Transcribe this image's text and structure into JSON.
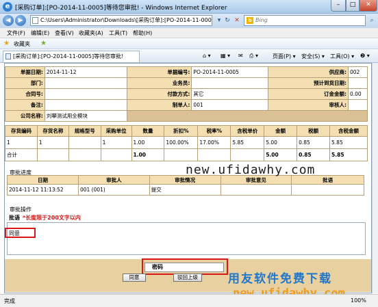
{
  "window": {
    "title": "[采购订单]:[PO-2014-11-0005]等待您审批! - Windows Internet Explorer"
  },
  "addressbar": {
    "url": "C:\\Users\\Administrator\\Downloads\\[采购订单]:[PO-2014-11-0005",
    "search_placeholder": "Bing"
  },
  "menu": [
    "文件(F)",
    "编辑(E)",
    "查看(V)",
    "收藏夹(A)",
    "工具(T)",
    "帮助(H)"
  ],
  "favorites": {
    "label": "收藏夹"
  },
  "tab": {
    "label": "[采购订单]:[PO-2014-11-0005]等待您审批!"
  },
  "commandbar": {
    "page": "页面(P) ▾",
    "safety": "安全(S) ▾",
    "tools": "工具(O) ▾",
    "help": "❷ ▾"
  },
  "header_form": {
    "doc_date_label": "单据日期:",
    "doc_date": "2014-11-12",
    "doc_no_label": "单据编号:",
    "doc_no": "PO-2014-11-0005",
    "supplier_label": "供应商:",
    "supplier": "002",
    "dept_label": "部门:",
    "dept": "",
    "salesman_label": "业务员:",
    "salesman": "",
    "arrival_label": "预计到货日期:",
    "arrival": "",
    "contract_label": "合同号:",
    "contract": "",
    "payment_label": "付款方式:",
    "payment": "其它",
    "deposit_label": "订金金额:",
    "deposit": "0.00",
    "remark_label": "备注:",
    "remark": "",
    "maker_label": "制单人:",
    "maker": "001",
    "auditor_label": "审核人:",
    "auditor": "",
    "company_label": "公司名称:",
    "company": "刘攀测试用全模块"
  },
  "lines": {
    "headers": [
      "存货编码",
      "存货名称",
      "规格型号",
      "采购单位",
      "数量",
      "折扣%",
      "税率%",
      "含税单价",
      "金额",
      "税额",
      "含税金额"
    ],
    "rows": [
      [
        "1",
        "1",
        "",
        "1",
        "1.00",
        "100.00%",
        "17.00%",
        "5.85",
        "5.00",
        "0.85",
        "5.85"
      ]
    ],
    "total": [
      "合计",
      "",
      "",
      "",
      "1.00",
      "",
      "",
      "",
      "5.00",
      "0.85",
      "5.85"
    ]
  },
  "approval": {
    "section_label": "审批进度",
    "headers": [
      "日期",
      "审批人",
      "审批情况",
      "审批意见",
      "批语"
    ],
    "rows": [
      [
        "2014-11-12 11:13:52",
        "001 (001)",
        "提交",
        "",
        ""
      ]
    ]
  },
  "operation": {
    "section_label": "审批操作",
    "remark_label": "批语",
    "remark_hint": "*长度限于200文字以内",
    "remark_text": "同意",
    "password_label": "密码",
    "agree_button": "同意",
    "return_button": "驳回上级"
  },
  "watermark": {
    "url": "new.ufidawhy.com",
    "brand": "用友软件免费下载",
    "url2": "new.ufidawhy.com"
  },
  "status": {
    "text": "完成",
    "zoom": "100%"
  }
}
